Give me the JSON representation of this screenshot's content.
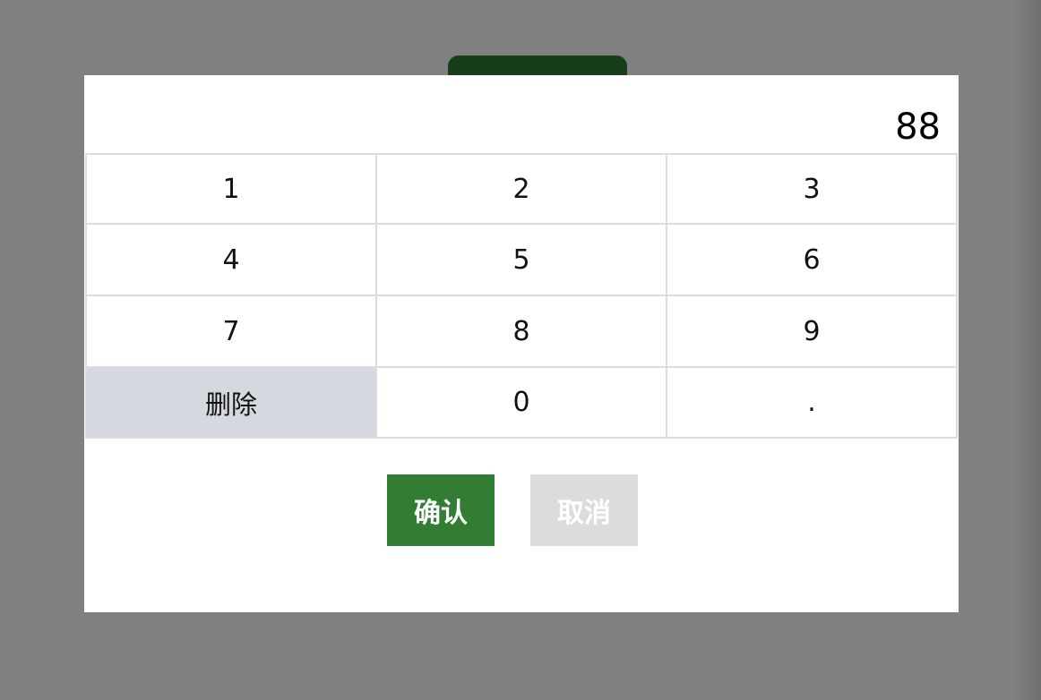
{
  "display": {
    "value": "88"
  },
  "keypad": {
    "keys": [
      {
        "label": "1"
      },
      {
        "label": "2"
      },
      {
        "label": "3"
      },
      {
        "label": "4"
      },
      {
        "label": "5"
      },
      {
        "label": "6"
      },
      {
        "label": "7"
      },
      {
        "label": "8"
      },
      {
        "label": "9"
      },
      {
        "label": "删除"
      },
      {
        "label": "0"
      },
      {
        "label": "."
      }
    ]
  },
  "actions": {
    "confirm_label": "确认",
    "cancel_label": "取消"
  },
  "colors": {
    "overlay": "#808080",
    "confirm": "#337c33",
    "cancel": "#dcdcdc",
    "delete_key": "#d5d9df",
    "tab": "#173e18"
  }
}
